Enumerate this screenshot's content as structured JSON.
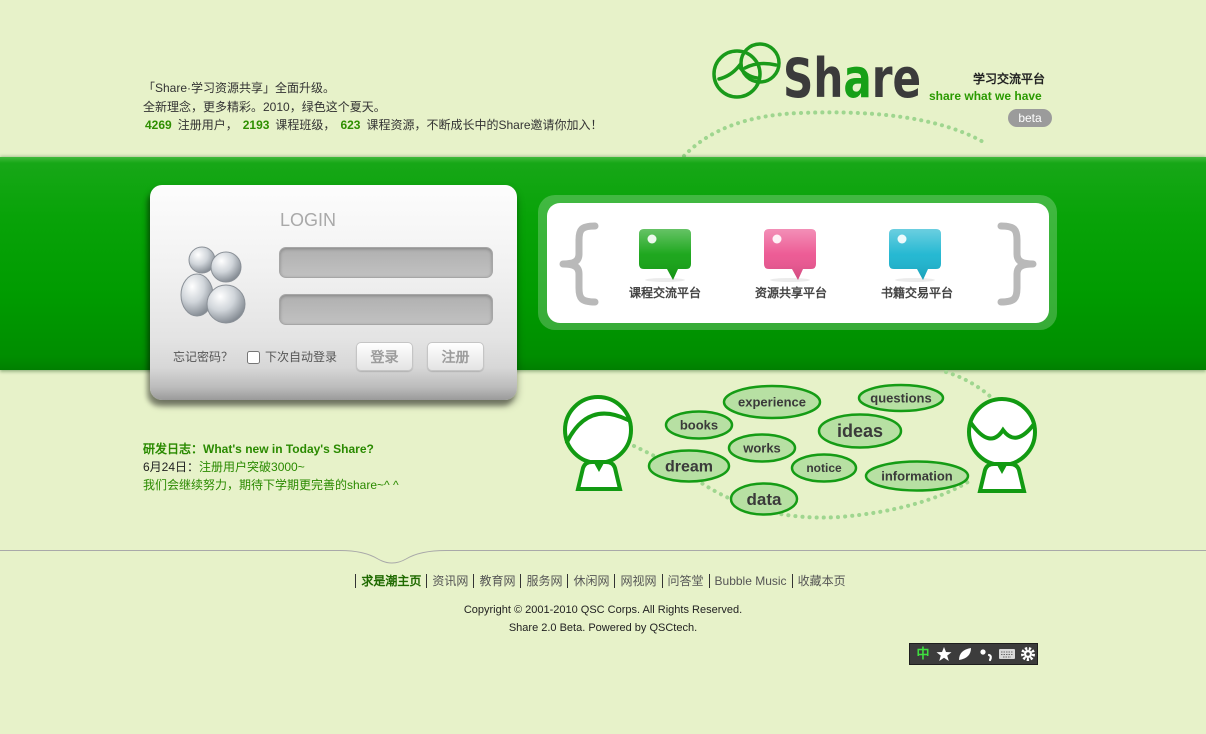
{
  "page": {
    "background": "#e7f2c9",
    "accent": "#129a12",
    "band_color": "#009b00"
  },
  "intro": {
    "line1": "「Share·学习资源共享」全面升级。",
    "line2": "全新理念，更多精彩。2010，绿色这个夏天。",
    "stats": [
      {
        "count": "4269",
        "label": "注册用户，"
      },
      {
        "count": "2193",
        "label": "课程班级，"
      },
      {
        "count": "623",
        "label": "课程资源，不断成长中的Share邀请你加入！"
      }
    ]
  },
  "logo": {
    "brand_start": "Sh",
    "brand_accent": "a",
    "brand_end": "re",
    "tagline_cn": "学习交流平台",
    "tagline_en": "share what we have",
    "badge": "beta"
  },
  "login": {
    "title": "LOGIN",
    "forgot_password": "忘记密码？",
    "remember_me": "下次自动登录",
    "remember_me_checked": false,
    "login_button": "登录",
    "register_button": "注册",
    "icon": "users-icon"
  },
  "platforms": [
    {
      "label": "课程交流平台",
      "icon": "speech-bubble-icon",
      "color": "#13a313"
    },
    {
      "label": "资源共享平台",
      "icon": "speech-bubble-icon",
      "color": "#ec5490"
    },
    {
      "label": "书籍交易平台",
      "icon": "speech-bubble-icon",
      "color": "#1bb5d0"
    }
  ],
  "word_cloud": [
    "experience",
    "questions",
    "books",
    "ideas",
    "works",
    "dream",
    "notice",
    "information",
    "data"
  ],
  "devlog": {
    "title": "研发日志：What's new in Today's Share?",
    "date": "6月24日：",
    "entry": "注册用户突破3000~",
    "note": "我们会继续努力，期待下学期更完善的share~^ ^"
  },
  "footer": {
    "links": [
      "求是潮主页",
      "资讯网",
      "教育网",
      "服务网",
      "休闲网",
      "网视网",
      "问答堂",
      "Bubble Music",
      "收藏本页"
    ],
    "copyright": "Copyright © 2001-2010 QSC Corps. All Rights Reserved.",
    "powered_by": "Share 2.0 Beta. Powered by QSCtech."
  },
  "ime_toolbar": {
    "mode_label": "中",
    "icons": [
      "star-icon",
      "leaf-icon",
      "punctuation-icon",
      "keyboard-icon",
      "gear-icon"
    ]
  }
}
